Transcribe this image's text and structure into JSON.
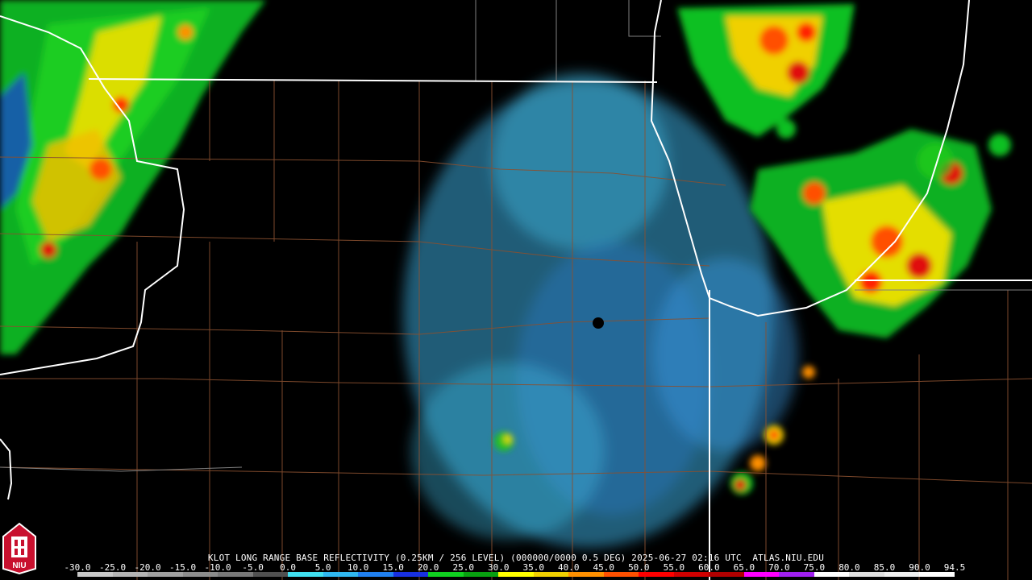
{
  "header": {
    "title": "KLOT LONG RANGE BASE REFLECTIVITY (0.25KM / 256 LEVEL) (000000/0000 0.5 DEG) 2025-06-27 02:16 UTC  ATLAS.NIU.EDU"
  },
  "scale": {
    "labels": [
      "-30.0",
      "-25.0",
      "-20.0",
      "-15.0",
      "-10.0",
      "-5.0",
      "0.0",
      "5.0",
      "10.0",
      "15.0",
      "20.0",
      "25.0",
      "30.0",
      "35.0",
      "40.0",
      "45.0",
      "50.0",
      "55.0",
      "60.0",
      "65.0",
      "70.0",
      "75.0",
      "80.0",
      "85.0",
      "90.0",
      "94.5"
    ],
    "colors": [
      "#c8c8c8",
      "#b4b4b4",
      "#a0a0a0",
      "#8c8c8c",
      "#787878",
      "#505050",
      "#40e0f0",
      "#30b8f0",
      "#2080f0",
      "#1830e0",
      "#10d020",
      "#08a010",
      "#ffff00",
      "#f0d000",
      "#ff9000",
      "#ff5000",
      "#ff0000",
      "#d00000",
      "#b00000",
      "#ff00ff",
      "#a020f0",
      "#ffffff",
      "#e0e0e0",
      "#f0f0f0",
      "#ffffff"
    ]
  },
  "logo": {
    "text": "NIU",
    "color": "#c8102e"
  },
  "map": {
    "radar_site": "KLOT",
    "boundary_color": "#ffffff",
    "county_color": "#8a5030"
  }
}
